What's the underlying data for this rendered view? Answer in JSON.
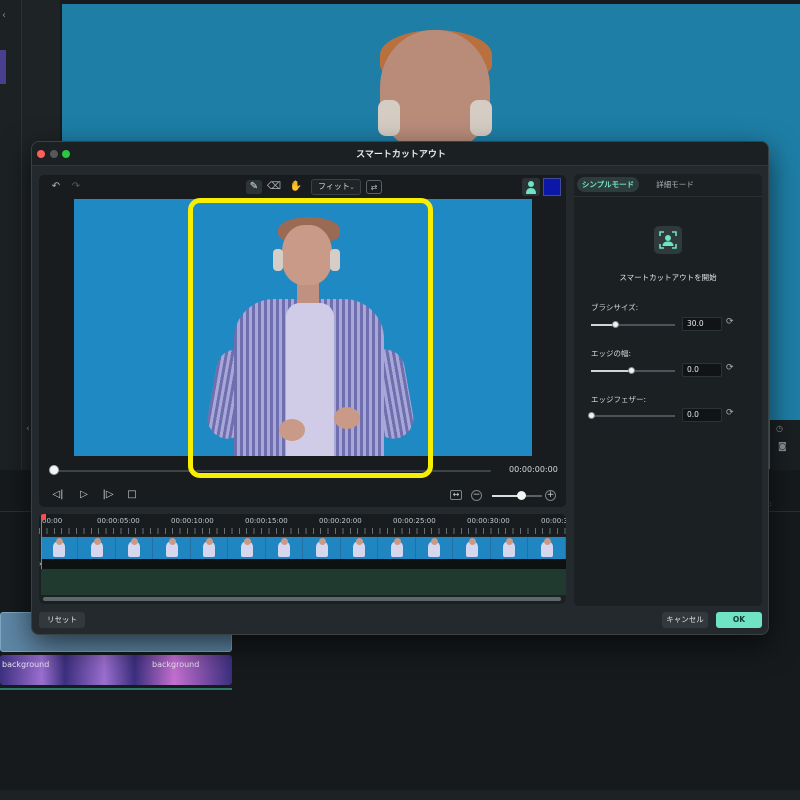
{
  "background_app": {
    "track_label_1": "background",
    "track_label_2": "background"
  },
  "dialog": {
    "title": "スマートカットアウト",
    "toolbar": {
      "undo_icon": "undo-icon",
      "redo_icon": "redo-icon",
      "brush_icon": "brush-icon",
      "eraser_icon": "eraser-icon",
      "hand_icon": "hand-icon",
      "fit_label": "フィット",
      "swap_icon": "swap-icon",
      "person_icon": "person-icon",
      "swatch_color": "#0c17a8"
    },
    "playback": {
      "timecode": "00:00:00:00",
      "progress": 0,
      "zoom_level": 0.55
    },
    "timeline": {
      "ticks": [
        "00:00",
        "00:00:05:00",
        "00:00:10:00",
        "00:00:15:00",
        "00:00:20:00",
        "00:00:25:00",
        "00:00:30:00",
        "00:00:3"
      ]
    },
    "panel": {
      "tabs": [
        {
          "label": "シンプルモード",
          "active": true
        },
        {
          "label": "詳細モード",
          "active": false
        }
      ],
      "start_label": "スマートカットアウトを開始",
      "params": [
        {
          "label": "ブラシサイズ:",
          "value": "30.0",
          "level": 0.28
        },
        {
          "label": "エッジの幅:",
          "value": "0.0",
          "level": 0.48
        },
        {
          "label": "エッジフェザー:",
          "value": "0.0",
          "level": 0.0
        }
      ]
    },
    "buttons": {
      "reset": "リセット",
      "cancel": "キャンセル",
      "ok": "OK"
    }
  },
  "colors": {
    "accent": "#6fe3c3",
    "highlight": "#f8ef00",
    "preview_bg": "#1f89c3"
  }
}
